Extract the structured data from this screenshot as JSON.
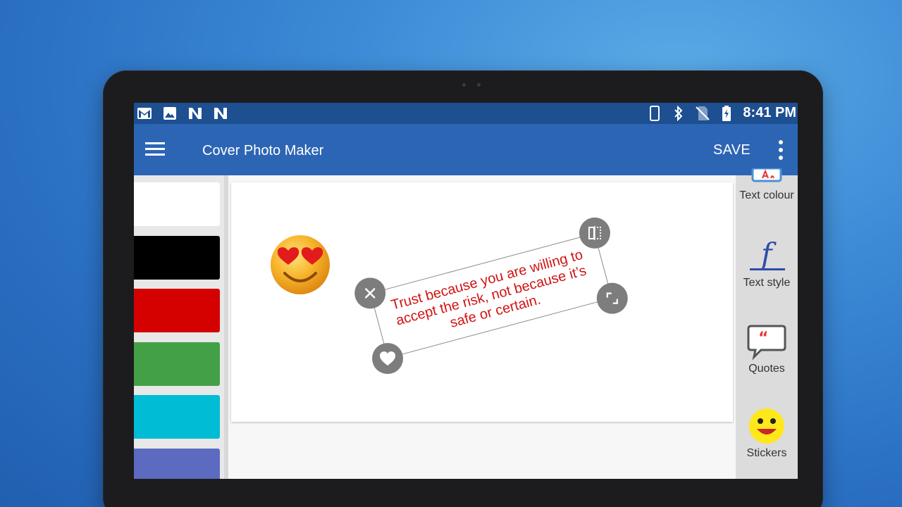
{
  "statusbar": {
    "time": "8:41 PM",
    "left_icons": [
      "gmail-icon",
      "gallery-icon",
      "n-notification-icon",
      "n-notification-icon"
    ],
    "right_icons": [
      "phone-icon",
      "bluetooth-icon",
      "no-sim-icon",
      "battery-charging-icon"
    ]
  },
  "appbar": {
    "title": "Cover Photo Maker",
    "save_label": "SAVE"
  },
  "palette": {
    "colors": [
      "#ffffff",
      "#000000",
      "#d50000",
      "#43a047",
      "#00bcd4",
      "#5c6bc0"
    ]
  },
  "canvas": {
    "sticker": "heart-eyes-emoji",
    "quote_text": "Trust because you are willing to accept the risk, not because it’s safe or certain.",
    "text_color": "#d11414",
    "handle_icons": [
      "close-icon",
      "flip-icon",
      "resize-icon",
      "heart-icon"
    ]
  },
  "tools": [
    {
      "label": "Text colour",
      "icon": "text-colour-icon"
    },
    {
      "label": "Text style",
      "icon": "text-style-icon"
    },
    {
      "label": "Quotes",
      "icon": "quotes-icon"
    },
    {
      "label": "Stickers",
      "icon": "stickers-icon"
    }
  ]
}
